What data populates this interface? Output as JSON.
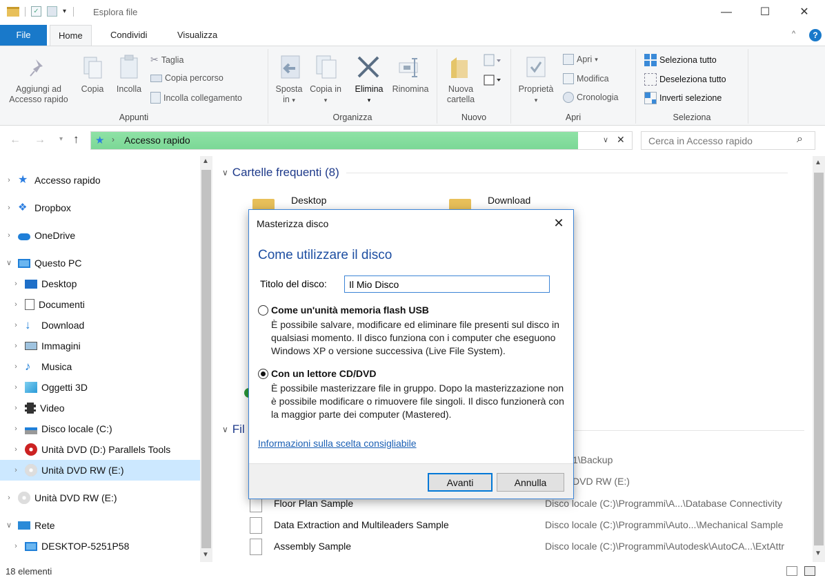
{
  "window": {
    "title": "Esplora file",
    "minimize": "—",
    "maximize": "☐",
    "close": "✕"
  },
  "tabs": [
    {
      "label": "File"
    },
    {
      "label": "Home"
    },
    {
      "label": "Condividi"
    },
    {
      "label": "Visualizza"
    }
  ],
  "ribbon": {
    "appunti": {
      "name": "Appunti",
      "pin": "Aggiungi ad Accesso rapido",
      "copy": "Copia",
      "paste": "Incolla",
      "cut": "Taglia",
      "copy_path": "Copia percorso",
      "paste_link": "Incolla collegamento"
    },
    "organizza": {
      "name": "Organizza",
      "move": "Sposta in",
      "copyto": "Copia in",
      "delete": "Elimina",
      "rename": "Rinomina"
    },
    "nuovo": {
      "name": "Nuovo",
      "new_folder": "Nuova cartella"
    },
    "apri": {
      "name": "Apri",
      "properties": "Proprietà",
      "open": "Apri",
      "edit": "Modifica",
      "history": "Cronologia"
    },
    "seleziona": {
      "name": "Seleziona",
      "select_all": "Seleziona tutto",
      "deselect_all": "Deseleziona tutto",
      "invert": "Inverti selezione"
    }
  },
  "address": {
    "location": "Accesso rapido",
    "search_placeholder": "Cerca in Accesso rapido"
  },
  "nav": [
    {
      "label": "Accesso rapido"
    },
    {
      "label": "Dropbox"
    },
    {
      "label": "OneDrive"
    },
    {
      "label": "Questo PC"
    },
    {
      "label": "Desktop"
    },
    {
      "label": "Documenti"
    },
    {
      "label": "Download"
    },
    {
      "label": "Immagini"
    },
    {
      "label": "Musica"
    },
    {
      "label": "Oggetti 3D"
    },
    {
      "label": "Video"
    },
    {
      "label": "Disco locale (C:)"
    },
    {
      "label": "Unità DVD (D:) Parallels Tools"
    },
    {
      "label": "Unità DVD RW (E:)"
    },
    {
      "label": "Unità DVD RW (E:)"
    },
    {
      "label": "Rete"
    },
    {
      "label": "DESKTOP-5251P58"
    }
  ],
  "content": {
    "frequent_header": "Cartelle frequenti (8)",
    "files_header_partial": "Fil",
    "folders": [
      {
        "name": "Desktop"
      },
      {
        "name": "Download"
      }
    ],
    "rows": [
      {
        "name": "",
        "path": "1\\Backup"
      },
      {
        "name": "",
        "path": "DVD RW (E:)"
      },
      {
        "name": "Floor Plan Sample",
        "path": "Disco locale (C:)\\Programmi\\A...\\Database Connectivity"
      },
      {
        "name": "Data Extraction and Multileaders Sample",
        "path": "Disco locale (C:)\\Programmi\\Auto...\\Mechanical Sample"
      },
      {
        "name": "Assembly Sample",
        "path": "Disco locale (C:)\\Programmi\\Autodesk\\AutoCA...\\ExtAttr"
      }
    ]
  },
  "status": {
    "count": "18 elementi"
  },
  "dialog": {
    "title": "Masterizza disco",
    "heading": "Come utilizzare il disco",
    "disc_title_label": "Titolo del disco:",
    "disc_title_value": "Il Mio Disco",
    "option_usb": {
      "label": "Come un'unità memoria flash USB",
      "desc": "È possibile salvare, modificare ed eliminare file presenti sul disco in qualsiasi momento. Il disco funziona con i computer che eseguono Windows XP o versione successiva (Live File System)."
    },
    "option_cd": {
      "label": "Con un lettore CD/DVD",
      "desc": "È possibile masterizzare file in gruppo. Dopo la masterizzazione non è possibile modificare o rimuovere file singoli. Il disco funzionerà con la maggior parte dei computer (Mastered)."
    },
    "selected_option": "option_cd",
    "info_link": "Informazioni sulla scelta consigliabile",
    "next_button": "Avanti",
    "cancel_button": "Annulla"
  }
}
